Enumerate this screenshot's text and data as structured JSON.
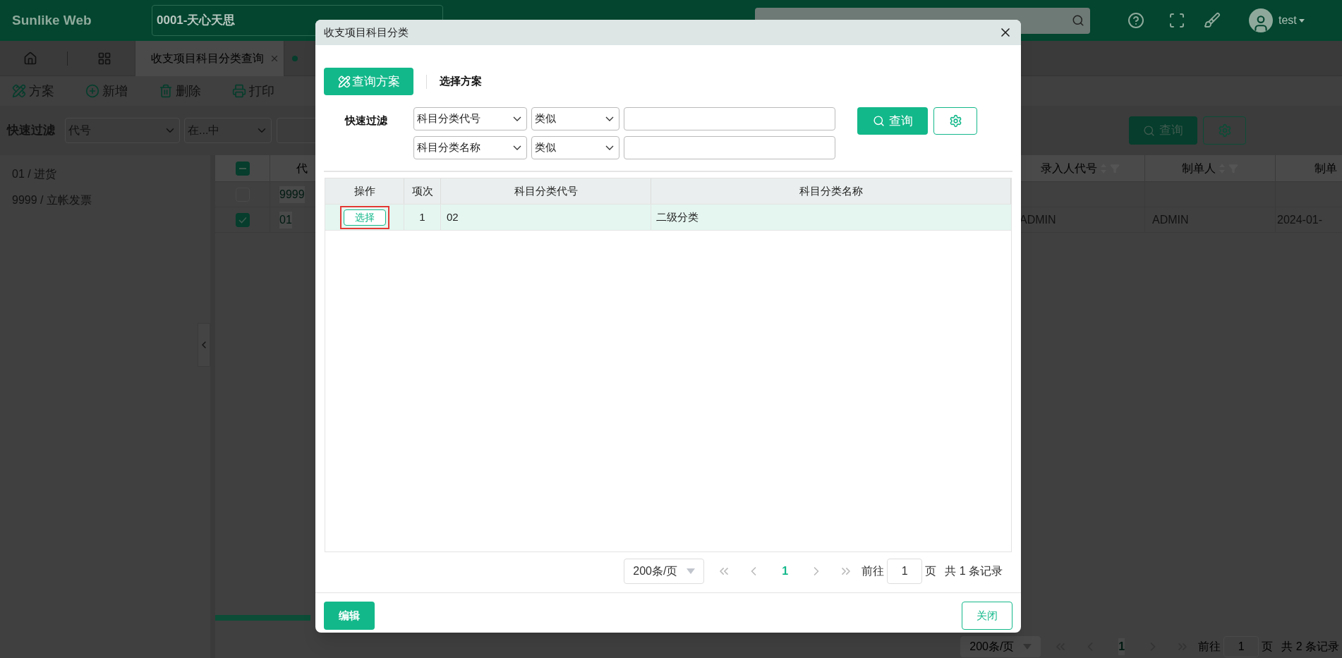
{
  "header": {
    "brand": "Sunlike Web",
    "company": "0001-天心天思",
    "user": "test"
  },
  "tabs": [
    {
      "label": "收支项目科目分类查询",
      "selected": false
    },
    {
      "selected": true
    }
  ],
  "toolbar": [
    {
      "kind": "scheme",
      "label": "方案"
    },
    {
      "kind": "add",
      "label": "新增"
    },
    {
      "kind": "delete",
      "label": "删除"
    },
    {
      "kind": "print",
      "label": "打印"
    }
  ],
  "filter": {
    "label": "快速过滤",
    "field": "代号",
    "operator": "在...中",
    "search": "查询"
  },
  "tree": [
    {
      "label": "01 / 进货"
    },
    {
      "label": "9999 / 立帐发票"
    }
  ],
  "table": {
    "indeterminate": true,
    "columns": [
      "代",
      "录入人代号",
      "制单人",
      "制单"
    ],
    "rows": [
      {
        "checked": false,
        "code": "9999"
      },
      {
        "checked": true,
        "code": "01",
        "entered_by": "ADMIN",
        "creator": "ADMIN",
        "created": "2024-01-"
      }
    ]
  },
  "pager": {
    "page_size": "200条/页",
    "page": "1",
    "goto_label": "前往",
    "goto": "1",
    "page_unit": "页",
    "total": "共 2 条记录"
  },
  "dialog": {
    "title": "收支项目科目分类",
    "scheme_button": "查询方案",
    "scheme_select": "选择方案",
    "filter_label": "快速过滤",
    "filters": [
      {
        "field": "科目分类代号",
        "operator": "类似"
      },
      {
        "field": "科目分类名称",
        "operator": "类似"
      }
    ],
    "search": "查询",
    "columns": [
      "操作",
      "项次",
      "科目分类代号",
      "科目分类名称"
    ],
    "rows": [
      {
        "action": "选择",
        "index": "1",
        "code": "02",
        "name": "二级分类",
        "selected": true,
        "highlighted": true
      }
    ],
    "pager": {
      "page_size": "200条/页",
      "page": "1",
      "goto_label": "前往",
      "goto": "1",
      "page_unit": "页",
      "total": "共 1 条记录"
    },
    "edit": "编辑",
    "close": "关闭"
  }
}
